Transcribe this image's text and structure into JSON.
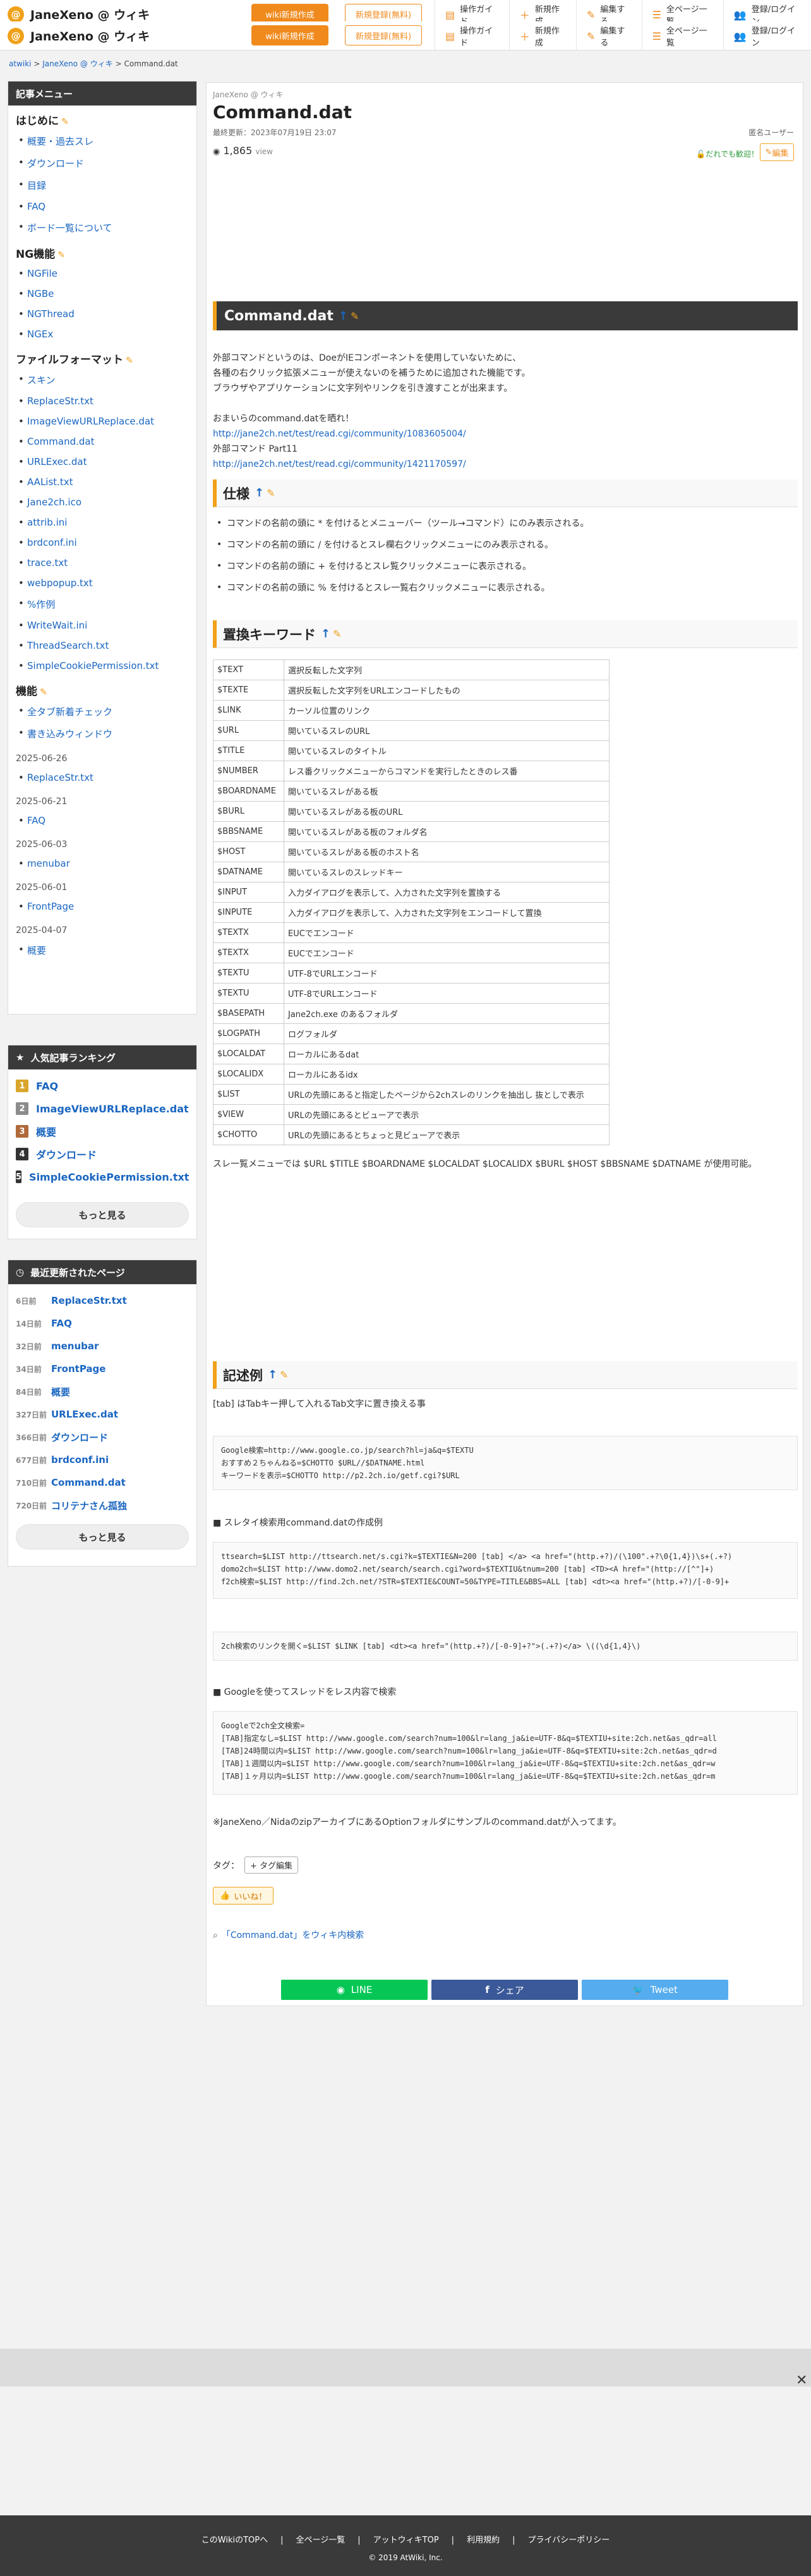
{
  "header": {
    "site_name": "JaneXeno @ ウィキ",
    "wiki_new": "wiki新規作成",
    "login_free": "新規登録(無料)",
    "nav": [
      "操作ガイド",
      "新規作成",
      "編集する",
      "全ページ一覧",
      "登録/ログイン"
    ]
  },
  "breadcrumb": {
    "home": "atwiki",
    "sep": ">",
    "wiki": "JaneXeno @ ウィキ",
    "page": "Command.dat"
  },
  "sidebar": {
    "title": "記事メニュー",
    "sections": [
      {
        "title": "はじめに",
        "items": [
          "概要・過去スレ",
          "ダウンロード",
          "目録",
          "FAQ",
          "ボード一覧について"
        ]
      },
      {
        "title": "NG機能",
        "items": [
          "NGFile",
          "NGBe",
          "NGThread",
          "NGEx"
        ]
      },
      {
        "title": "ファイルフォーマット",
        "items": [
          "スキン",
          "ReplaceStr.txt",
          "ImageViewURLReplace.dat",
          "Command.dat",
          "URLExec.dat",
          "AAList.txt",
          "Jane2ch.ico",
          "attrib.ini",
          "brdconf.ini",
          "trace.txt",
          "webpopup.txt",
          "%作例",
          "WriteWait.ini",
          "ThreadSearch.txt",
          "SimpleCookiePermission.txt"
        ]
      },
      {
        "title": "機能",
        "items": [
          "全タブ新着チェック",
          "書き込みウィンドウ"
        ]
      }
    ],
    "updates": [
      {
        "date": "2025-06-26",
        "items": [
          "ReplaceStr.txt"
        ]
      },
      {
        "date": "2025-06-21",
        "items": [
          "FAQ"
        ]
      },
      {
        "date": "2025-06-03",
        "items": [
          "menubar"
        ]
      },
      {
        "date": "2025-06-01",
        "items": [
          "FrontPage"
        ]
      },
      {
        "date": "2025-04-07",
        "items": [
          "概要"
        ]
      }
    ]
  },
  "ranking": {
    "title": "人気記事ランキング",
    "items": [
      "FAQ",
      "ImageViewURLReplace.dat",
      "概要",
      "ダウンロード",
      "SimpleCookiePermission.txt"
    ],
    "more": "もっと見る",
    "colors": [
      "#d9a62b",
      "#8c8c8c",
      "#b06a3a",
      "#333333",
      "#333333"
    ]
  },
  "recent": {
    "title": "最近更新されたページ",
    "items": [
      {
        "ago": "6日前",
        "name": "ReplaceStr.txt"
      },
      {
        "ago": "14日前",
        "name": "FAQ"
      },
      {
        "ago": "32日前",
        "name": "menubar"
      },
      {
        "ago": "34日前",
        "name": "FrontPage"
      },
      {
        "ago": "84日前",
        "name": "概要"
      },
      {
        "ago": "327日前",
        "name": "URLExec.dat"
      },
      {
        "ago": "366日前",
        "name": "ダウンロード"
      },
      {
        "ago": "677日前",
        "name": "brdconf.ini"
      },
      {
        "ago": "710日前",
        "name": "Command.dat"
      },
      {
        "ago": "720日前",
        "name": "コリテナさん孤独"
      }
    ],
    "more": "もっと見る"
  },
  "page": {
    "wiki_name": "JaneXeno @ ウィキ",
    "title": "Command.dat",
    "updated": "最終更新：2023年07月19日 23:07",
    "author": "匿名ユーザー",
    "views": "1,865",
    "views_unit": "view",
    "edit_anyone": "だれでも歓迎！",
    "edit_label": "編集",
    "section_main": "Command.dat",
    "intro": [
      "外部コマンドというのは、DoeがIEコンポーネントを使用していないために、",
      "各種の右クリック拡張メニューが使えないのを補うために追加された機能です。",
      "ブラウザやアプリケーションに文字列やリンクを引き渡すことが出来ます。",
      "",
      "おまいらのcommand.datを晒れ！",
      "http://jane2ch.net/test/read.cgi/community/1083605004/",
      "外部コマンド Part11",
      "http://jane2ch.net/test/read.cgi/community/1421170597/"
    ],
    "spec_title": "仕様",
    "spec": [
      "コマンドの名前の頭に * を付けるとメニューバー（ツール→コマンド）にのみ表示される。",
      "コマンドの名前の頭に / を付けるとスレ欄右クリックメニューにのみ表示される。",
      "コマンドの名前の頭に + を付けるとスレ覧クリックメニューに表示される。",
      "コマンドの名前の頭に % を付けるとスレ一覧右クリックメニューに表示される。"
    ],
    "kw_title": "置換キーワード",
    "keywords": [
      [
        "$TEXT",
        "選択反転した文字列"
      ],
      [
        "$TEXTE",
        "選択反転した文字列をURLエンコードしたもの"
      ],
      [
        "$LINK",
        "カーソル位置のリンク"
      ],
      [
        "$URL",
        "開いているスレのURL"
      ],
      [
        "$TITLE",
        "開いているスレのタイトル"
      ],
      [
        "$NUMBER",
        "レス番クリックメニューからコマンドを実行したときのレス番"
      ],
      [
        "$BOARDNAME",
        "開いているスレがある板"
      ],
      [
        "$BURL",
        "開いているスレがある板のURL"
      ],
      [
        "$BBSNAME",
        "開いているスレがある板のフォルダ名"
      ],
      [
        "$HOST",
        "開いているスレがある板のホスト名"
      ],
      [
        "$DATNAME",
        "開いているスレのスレッドキー"
      ],
      [
        "$INPUT",
        "入力ダイアログを表示して、入力された文字列を置換する"
      ],
      [
        "$INPUTE",
        "入力ダイアログを表示して、入力された文字列をエンコードして置換"
      ],
      [
        "$TEXTX",
        "EUCでエンコード"
      ],
      [
        "$TEXTX",
        "EUCでエンコード"
      ],
      [
        "$TEXTU",
        "UTF-8でURLエンコード"
      ],
      [
        "$TEXTU",
        "UTF-8でURLエンコード"
      ],
      [
        "$BASEPATH",
        "Jane2ch.exe のあるフォルダ"
      ],
      [
        "$LOGPATH",
        "ログフォルダ"
      ],
      [
        "$LOCALDAT",
        "ローカルにあるdat"
      ],
      [
        "$LOCALIDX",
        "ローカルにあるidx"
      ],
      [
        "$LIST",
        "URLの先頭にあると指定したページから2chスレのリンクを抽出し 抜としで表示"
      ],
      [
        "$VIEW",
        "URLの先頭にあるとビューアで表示"
      ],
      [
        "$CHOTTO",
        "URLの先頭にあるとちょっと見ビューアで表示"
      ]
    ],
    "kw_note": "スレ一覧メニューでは $URL $TITLE $BOARDNAME $LOCALDAT $LOCALIDX $BURL $HOST $BBSNAME $DATNAME が使用可能。",
    "ex_title": "記述例",
    "ex_note": "[tab] はTabキー押して入れるTab文字に置き換える事",
    "code1": "Google検索=http://www.google.co.jp/search?hl=ja&q=$TEXTU\nおすすめ２ちゃんねる=$CHOTTO $URL//$DATNAME.html\nキーワードを表示=$CHOTTO http://p2.2ch.io/getf.cgi?$URL",
    "ex2_title": "■ スレタイ検索用command.datの作成例",
    "code2": "ttsearch=$LIST http://ttsearch.net/s.cgi?k=$TEXTIE&N=200 [tab] </a> <a href=\"(http.+?)/(\\100\".+?\\0{1,4})\\s+(.+?)\ndomo2ch=$LIST http://www.domo2.net/search/search.cgi?word=$TEXTIU&tnum=200 [tab] <TD><A href=\"(http://[^\"]+)\nf2ch検索=$LIST http://find.2ch.net/?STR=$TEXTIE&COUNT=50&TYPE=TITLE&BBS=ALL [tab] <dt><a href=\"(http.+?)/[-0-9]+",
    "code3": "2ch検索のリンクを開く=$LIST $LINK [tab] <dt><a href=\"(http.+?)/[-0-9]+?\">(.+?)</a> \\((\\d{1,4}\\)",
    "ex3_title": "■ Googleを使ってスレッドをレス内容で検索",
    "code4": "Googleで2ch全文検索=\n[TAB]指定なし=$LIST http://www.google.com/search?num=100&lr=lang_ja&ie=UTF-8&q=$TEXTIU+site:2ch.net&as_qdr=all\n[TAB]24時間以内=$LIST http://www.google.com/search?num=100&lr=lang_ja&ie=UTF-8&q=$TEXTIU+site:2ch.net&as_qdr=d\n[TAB]１週間以内=$LIST http://www.google.com/search?num=100&lr=lang_ja&ie=UTF-8&q=$TEXTIU+site:2ch.net&as_qdr=w\n[TAB]１ヶ月以内=$LIST http://www.google.com/search?num=100&lr=lang_ja&ie=UTF-8&q=$TEXTIU+site:2ch.net&as_qdr=m",
    "note": "※JaneXeno／NidaのzipアーカイブにあるOptionフォルダにサンプルのcommand.datが入ってます。",
    "tag_label": "タグ：",
    "tag_edit": "+ タグ編集",
    "like": "いいね！",
    "search_wiki": "「Command.dat」をウィキ内検索",
    "share": [
      "LINE",
      "シェア",
      "Tweet"
    ],
    "share_colors": [
      "#06c755",
      "#3b5998",
      "#55acee"
    ]
  },
  "footer": {
    "links": [
      "このWikiのTOPへ",
      "全ページ一覧",
      "アットウィキTOP",
      "利用規約",
      "プライバシーポリシー"
    ],
    "copy": "2019 AtWiki, Inc."
  }
}
